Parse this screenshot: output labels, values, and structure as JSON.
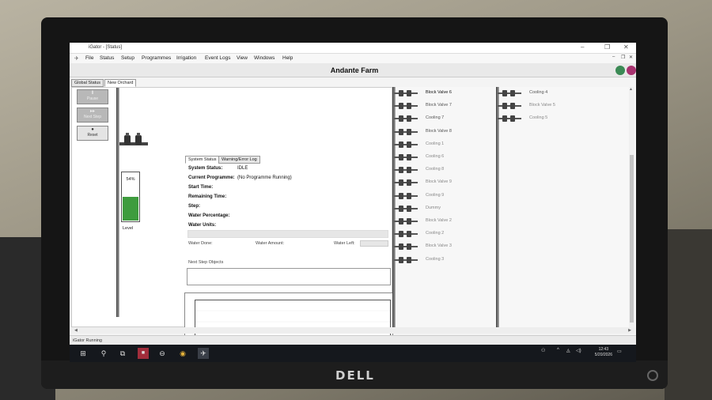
{
  "window": {
    "title": "iGator - [Status]",
    "menu": [
      "File",
      "Status",
      "Setup",
      "Programmes",
      "Irrigation",
      "Event Logs",
      "View",
      "Windows",
      "Help"
    ]
  },
  "header": {
    "farm_name": "Andante Farm"
  },
  "view_tabs": [
    "Global Status",
    "New Orchard"
  ],
  "controls": {
    "pause": "Pause",
    "next_step": "Next Step",
    "reset": "Reset"
  },
  "tank": {
    "percent_label": "54%",
    "level_fraction": 0.54,
    "level_label": "Level"
  },
  "status_tabs": [
    "System Status",
    "Warning/Error Log"
  ],
  "status": {
    "system_status_label": "System Status:",
    "system_status_value": "IDLE",
    "current_programme_label": "Current Programme:",
    "current_programme_value": "(No Programme Running)",
    "start_time_label": "Start Time:",
    "remaining_time_label": "Remaining Time:",
    "step_label": "Step:",
    "water_percentage_label": "Water Percentage:",
    "water_units_label": "Water Units:"
  },
  "water": {
    "done_label": "Water Done:",
    "amount_label": "Water Amount:",
    "left_label": "Water Left:"
  },
  "next_step_objects_label": "Next Step Objects",
  "valves_mid": [
    {
      "label": "Block Valve 6",
      "state": "active"
    },
    {
      "label": "Block Valve 7",
      "state": "mid"
    },
    {
      "label": "Cooling 7",
      "state": "mid"
    },
    {
      "label": "Block Valve 8",
      "state": "mid"
    },
    {
      "label": "Cooling 1",
      "state": "inactive"
    },
    {
      "label": "Cooling 6",
      "state": "inactive"
    },
    {
      "label": "Cooling 8",
      "state": "inactive"
    },
    {
      "label": "Block Valve 9",
      "state": "inactive"
    },
    {
      "label": "Cooling 9",
      "state": "inactive"
    },
    {
      "label": "Dummy",
      "state": "inactive"
    },
    {
      "label": "Block Valve 2",
      "state": "inactive"
    },
    {
      "label": "Cooling 2",
      "state": "inactive"
    },
    {
      "label": "Block Valve 3",
      "state": "inactive"
    },
    {
      "label": "Cooling 3",
      "state": "inactive"
    }
  ],
  "valves_right": [
    {
      "label": "Cooling 4",
      "state": "mid"
    },
    {
      "label": "Block Valve 5",
      "state": "inactive"
    },
    {
      "label": "Cooling 5",
      "state": "inactive"
    }
  ],
  "statusbar": {
    "text": "iGator Running"
  },
  "taskbar": {
    "time": "12:43",
    "date": "5/20/2026"
  },
  "monitor_brand": "DELL",
  "colors": {
    "tank_fill": "#3e9c3e",
    "valve_body": "#555555",
    "taskbar": "#15181d"
  },
  "icons": [
    "windows-start-icon",
    "search-icon",
    "task-view-icon",
    "app-icon",
    "chrome-icon",
    "igator-icon",
    "people-icon",
    "wifi-icon",
    "volume-icon",
    "notifications-icon"
  ]
}
